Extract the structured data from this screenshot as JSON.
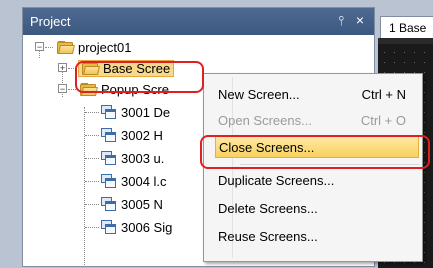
{
  "panel": {
    "title": "Project",
    "pin_glyph": "ᵖ",
    "close_glyph": "×"
  },
  "doc_tab": {
    "label": "1 Base"
  },
  "tree": {
    "root": "project01",
    "base": "Base Scree",
    "popup": "Popup Scre",
    "screens": [
      "3001 De",
      "3002 H",
      "3003 u.",
      "3004 l.c",
      "3005 N",
      "3006 Sig"
    ]
  },
  "menu": {
    "items": [
      {
        "label": "New Screen...",
        "shortcut": "Ctrl + N",
        "disabled": false
      },
      {
        "label": "Open Screens...",
        "shortcut": "Ctrl + O",
        "disabled": true
      },
      {
        "label": "Close Screens...",
        "shortcut": "",
        "disabled": false
      },
      {
        "label": "Duplicate Screens...",
        "shortcut": "",
        "disabled": false
      },
      {
        "label": "Delete Screens...",
        "shortcut": "",
        "disabled": false
      },
      {
        "label": "Reuse Screens...",
        "shortcut": "",
        "disabled": false
      }
    ]
  },
  "colors": {
    "highlight": "#f9d15e",
    "annotation": "#e02020",
    "header": "#3d587f"
  }
}
